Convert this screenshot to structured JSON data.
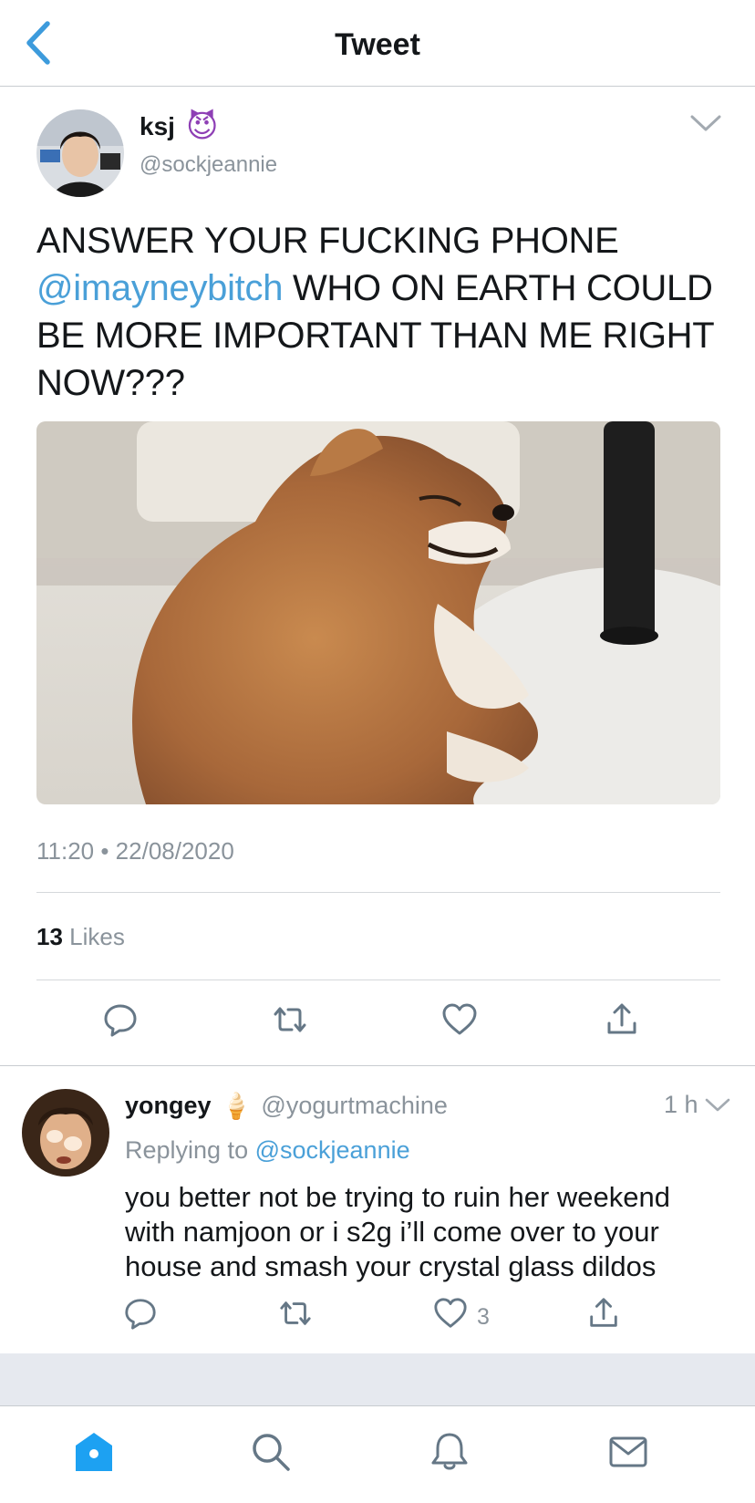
{
  "header": {
    "title": "Tweet",
    "back_icon": "chevron-left-icon"
  },
  "tweet": {
    "author": {
      "name": "ksj",
      "emoji": "😈",
      "handle": "@sockjeannie"
    },
    "text_parts": {
      "line1": "ANSWER YOUR FUCKING PHONE",
      "mention": "@imayneybitch",
      "rest": " WHO ON EARTH COULD BE MORE IMPORTANT THAN ME RIGHT NOW???"
    },
    "timestamp": "11:20 • 22/08/2020",
    "likes": {
      "count": "13",
      "label": " Likes"
    },
    "actions": [
      "reply-icon",
      "retweet-icon",
      "like-icon",
      "share-icon"
    ]
  },
  "reply": {
    "author": {
      "name": "yongey",
      "emoji": "🍦",
      "handle": "@yogurtmachine"
    },
    "time": "1 h",
    "replying_label": "Replying to ",
    "replying_to": "@sockjeannie",
    "text": "you better not be trying to ruin her weekend with namjoon or i s2g i’ll come over to your house and smash your crystal glass dildos",
    "like_count": "3"
  },
  "tabs": [
    "home-icon",
    "search-icon",
    "notifications-icon",
    "messages-icon"
  ],
  "colors": {
    "accent": "#1da1f2",
    "mention": "#4aa0d8",
    "muted": "#8a939b",
    "icon": "#657786"
  }
}
